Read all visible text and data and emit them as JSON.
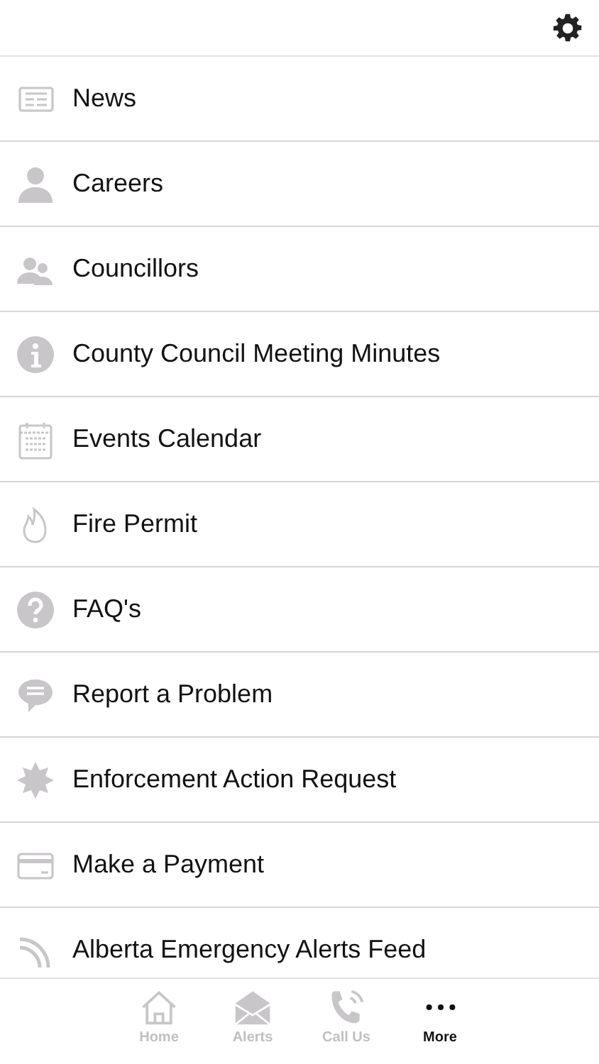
{
  "menu": [
    {
      "label": "News",
      "kind": "newspaper"
    },
    {
      "label": "Careers",
      "kind": "person"
    },
    {
      "label": "Councillors",
      "kind": "people"
    },
    {
      "label": "County Council Meeting Minutes",
      "kind": "info"
    },
    {
      "label": "Events Calendar",
      "kind": "calendar"
    },
    {
      "label": "Fire Permit",
      "kind": "flame"
    },
    {
      "label": "FAQ's",
      "kind": "question"
    },
    {
      "label": "Report a Problem",
      "kind": "chat"
    },
    {
      "label": "Enforcement Action Request",
      "kind": "star"
    },
    {
      "label": "Make a Payment",
      "kind": "card"
    },
    {
      "label": "Alberta Emergency Alerts Feed",
      "kind": "feed"
    }
  ],
  "tab_bar": [
    {
      "label": "Home",
      "kind": "home",
      "selected": false
    },
    {
      "label": "Alerts",
      "kind": "mail",
      "selected": false
    },
    {
      "label": "Call Us",
      "kind": "phone",
      "selected": false
    },
    {
      "label": "More",
      "kind": "more",
      "selected": true
    }
  ]
}
